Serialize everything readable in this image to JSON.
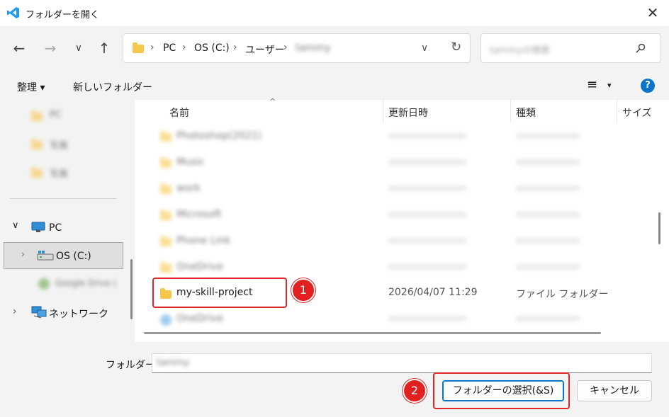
{
  "window": {
    "title": "フォルダーを開く",
    "close_glyph": "✕"
  },
  "nav": {
    "back": "←",
    "forward": "→",
    "history": "∨",
    "up": "↑",
    "breadcrumbs": [
      "PC",
      "OS (C:)",
      "ユーザー",
      "tammy"
    ],
    "dropdown": "∨",
    "refresh": "↻",
    "search_placeholder": "tammyの検索"
  },
  "toolbar": {
    "organize": "整理 ▾",
    "new_folder": "新しいフォルダー",
    "view": "≡",
    "view_caret": "▾",
    "help": "?"
  },
  "sidebar": {
    "blurred_top": [
      "PC",
      "写真",
      "写真"
    ],
    "pc": "PC",
    "os": "OS (C:)",
    "gdrive": "Google Drive (",
    "network": "ネットワーク"
  },
  "content": {
    "headers": {
      "name": "名前",
      "date": "更新日時",
      "type": "種類",
      "size": "サイズ"
    },
    "blurred_rows": [
      "Photoshop(2021)",
      "Music",
      "work",
      "Microsoft",
      "Phone Link",
      "OneDrive"
    ],
    "target_row": {
      "name": "my-skill-project",
      "date": "2026/04/07 11:29",
      "type": "ファイル フォルダー"
    },
    "last_blurred": "OneDrive"
  },
  "bottom": {
    "folder_label": "フォルダー:",
    "folder_value": "tammy",
    "select_button": "フォルダーの選択(&S)",
    "cancel_button": "キャンセル"
  },
  "annotations": {
    "step1": "1",
    "step2": "2"
  },
  "colors": {
    "accent": "#0a74c9",
    "highlight": "#e0262b",
    "folder": "#f5c74a"
  }
}
